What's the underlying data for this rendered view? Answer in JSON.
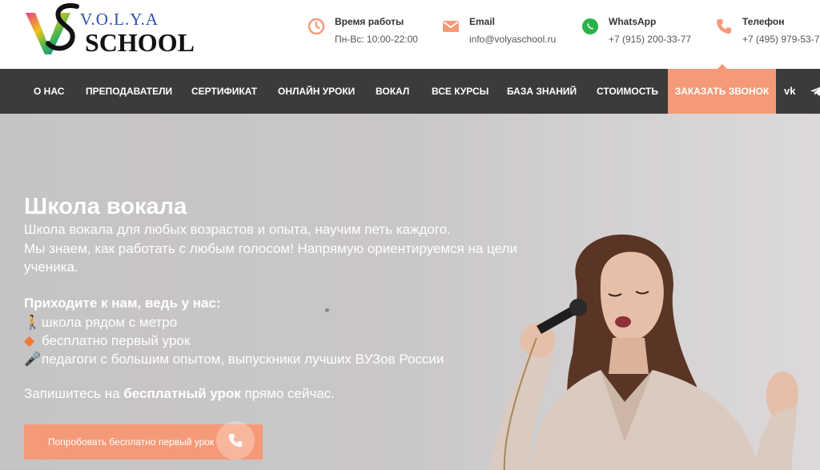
{
  "header": {
    "logo": {
      "top_text": "V.O.L.Y.A",
      "bottom_text": "SCHOOL"
    },
    "contacts": [
      {
        "icon": "clock-icon",
        "label": "Время работы",
        "value": "Пн-Вс: 10:00-22:00"
      },
      {
        "icon": "email-icon",
        "label": "Email",
        "value": "info@volyaschool.ru"
      },
      {
        "icon": "whatsapp-icon",
        "label": "WhatsApp",
        "value": "+7 (915) 200-33-77"
      },
      {
        "icon": "phone-icon",
        "label": "Телефон",
        "value": "+7 (495) 979-53-7"
      }
    ]
  },
  "nav": {
    "items": [
      "О НАС",
      "ПРЕПОДАВАТЕЛИ",
      "СЕРТИФИКАТ",
      "ОНЛАЙН УРОКИ",
      "ВОКАЛ",
      "ВСЕ КУРСЫ",
      "БАЗА ЗНАНИЙ",
      "СТОИМОСТЬ"
    ],
    "cta": "ЗАКАЗАТЬ ЗВОНОК",
    "social": [
      {
        "icon": "vk-icon",
        "text": "vk"
      },
      {
        "icon": "telegram-icon",
        "text": ""
      }
    ]
  },
  "hero": {
    "title": "Школа вокала",
    "lines": [
      "Школа вокала для любых возрастов и опыта, научим петь каждого.",
      "Мы знаем, как работать с любым голосом! Напрямую ориентируемся на цели",
      "ученика."
    ],
    "strong": "Приходите к нам, ведь у нас:",
    "features": [
      {
        "icon": "person-walking-icon",
        "text": "школа рядом с метро"
      },
      {
        "icon": "diamond-icon",
        "text": "бесплатно первый урок"
      },
      {
        "icon": "microphone-icon",
        "text": "педагоги с большим опытом, выпускники лучших ВУЗов России"
      }
    ],
    "cta_prefix": "Запишитесь на ",
    "cta_bold": "бесплатный урок",
    "cta_suffix": " прямо сейчас.",
    "button": "Попробовать бесплатно первый урок"
  },
  "colors": {
    "accent": "#f59a78",
    "nav_bg": "#3b3b3b",
    "hero_bg": "#c8c5c6"
  }
}
